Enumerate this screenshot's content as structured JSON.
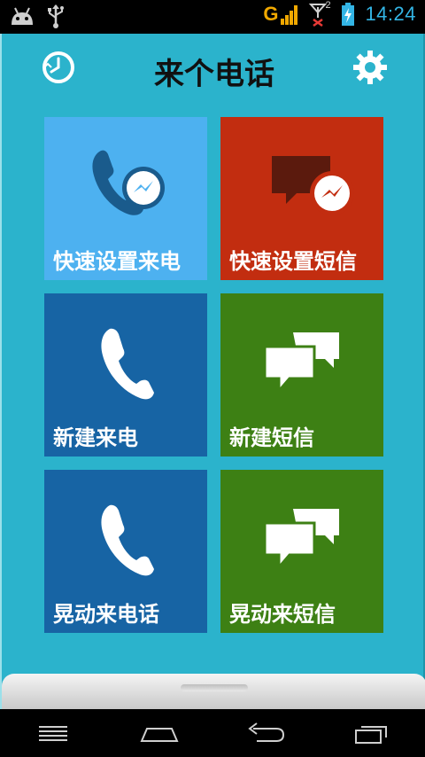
{
  "status_bar": {
    "network_type": "G",
    "sim2_indicator": "2",
    "time": "14:24"
  },
  "header": {
    "title": "来个电话"
  },
  "tiles": [
    {
      "label": "快速设置来电",
      "icon": "phone-with-badge-icon",
      "color": "#4db1f0"
    },
    {
      "label": "快速设置短信",
      "icon": "message-with-badge-icon",
      "color": "#c22d10"
    },
    {
      "label": "新建来电",
      "icon": "phone-icon",
      "color": "#1764a4"
    },
    {
      "label": "新建短信",
      "icon": "chat-bubbles-icon",
      "color": "#3d8014"
    },
    {
      "label": "晃动来电话",
      "icon": "phone-icon",
      "color": "#1764a4"
    },
    {
      "label": "晃动来短信",
      "icon": "chat-bubbles-icon",
      "color": "#3d8014"
    }
  ],
  "colors": {
    "app_background": "#2bb3cc",
    "status_accent": "#33b5e5"
  }
}
